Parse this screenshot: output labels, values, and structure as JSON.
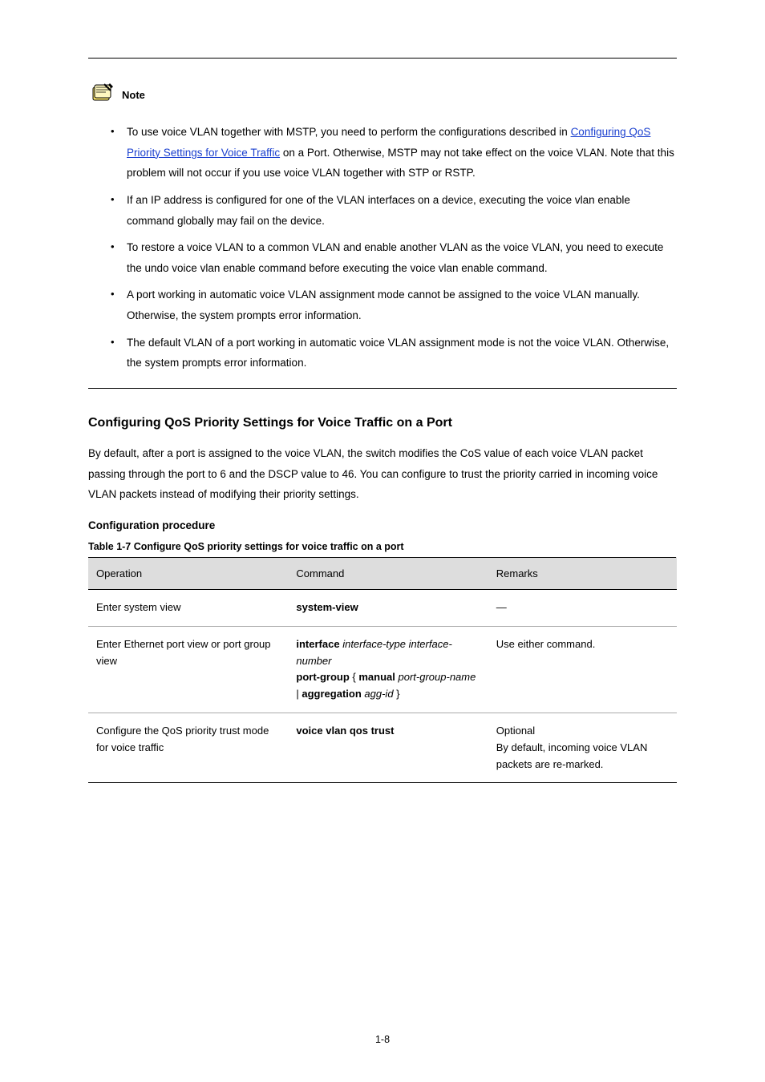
{
  "note": {
    "label": "Note",
    "bullets": [
      {
        "pre": "To use voice VLAN together with MSTP, you need to perform the configurations described in ",
        "link": "Configuring QoS Priority Settings for Voice Traffic",
        "post": " on a Port. Otherwise, MSTP may not take effect on the voice VLAN. Note that this problem will not occur if you use voice VLAN together with STP or RSTP."
      },
      {
        "text": "If an IP address is configured for one of the VLAN interfaces on a device, executing the voice vlan enable command globally may fail on the device."
      },
      {
        "text": "To restore a voice VLAN to a common VLAN and enable another VLAN as the voice VLAN, you need to execute the undo voice vlan enable command before executing the voice vlan enable command."
      },
      {
        "text": "A port working in automatic voice VLAN assignment mode cannot be assigned to the voice VLAN manually. Otherwise, the system prompts error information."
      },
      {
        "text": "The default VLAN of a port working in automatic voice VLAN assignment mode is not the voice VLAN. Otherwise, the system prompts error information."
      }
    ]
  },
  "section": {
    "title": "Configuring QoS Priority Settings for Voice Traffic on a Port",
    "para": "By default, after a port is assigned to the voice VLAN, the switch modifies the CoS value of each voice VLAN packet passing through the port to 6 and the DSCP value to 46. You can configure to trust the priority carried in incoming voice VLAN packets instead of modifying their priority settings."
  },
  "subsection": {
    "title": "Configuration procedure",
    "caption": "Table 1-7 Configure QoS priority settings for voice traffic on a port"
  },
  "table": {
    "headers": [
      "Operation",
      "Command",
      "Remarks"
    ],
    "rows": [
      [
        "Enter system view",
        [
          {
            "bold": "system-view"
          }
        ],
        "—"
      ],
      [
        "Enter Ethernet port view or port group view",
        [
          {
            "bold": "interface"
          },
          {
            "text": " "
          },
          {
            "italic": "interface-type interface-number"
          },
          {
            "text": "\n"
          },
          {
            "bold": "port-group"
          },
          {
            "text": " { "
          },
          {
            "bold": "manual"
          },
          {
            "text": " "
          },
          {
            "italic": "port-group-name"
          },
          {
            "text": " | "
          },
          {
            "bold": "aggregation"
          },
          {
            "text": " "
          },
          {
            "italic": "agg-id"
          },
          {
            "text": " }"
          }
        ],
        "Use either command."
      ],
      [
        "Configure the QoS priority trust mode for voice traffic",
        [
          {
            "bold": "voice vlan qos trust"
          }
        ],
        "Optional\nBy default, incoming voice VLAN packets are re-marked."
      ]
    ]
  },
  "pagenum": "1-8"
}
